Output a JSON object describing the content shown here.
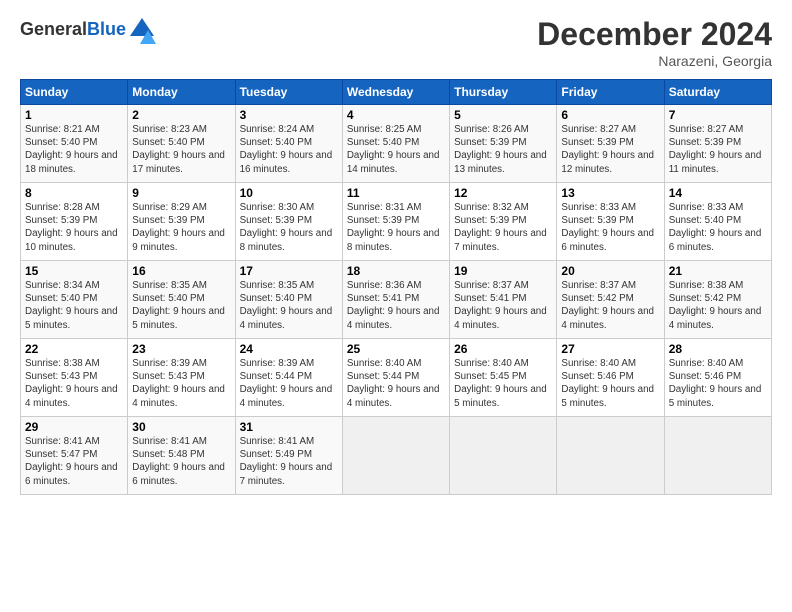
{
  "header": {
    "logo_line1": "General",
    "logo_line2": "Blue",
    "month": "December 2024",
    "location": "Narazeni, Georgia"
  },
  "weekdays": [
    "Sunday",
    "Monday",
    "Tuesday",
    "Wednesday",
    "Thursday",
    "Friday",
    "Saturday"
  ],
  "weeks": [
    [
      {
        "day": "1",
        "info": "Sunrise: 8:21 AM\nSunset: 5:40 PM\nDaylight: 9 hours and 18 minutes."
      },
      {
        "day": "2",
        "info": "Sunrise: 8:23 AM\nSunset: 5:40 PM\nDaylight: 9 hours and 17 minutes."
      },
      {
        "day": "3",
        "info": "Sunrise: 8:24 AM\nSunset: 5:40 PM\nDaylight: 9 hours and 16 minutes."
      },
      {
        "day": "4",
        "info": "Sunrise: 8:25 AM\nSunset: 5:40 PM\nDaylight: 9 hours and 14 minutes."
      },
      {
        "day": "5",
        "info": "Sunrise: 8:26 AM\nSunset: 5:39 PM\nDaylight: 9 hours and 13 minutes."
      },
      {
        "day": "6",
        "info": "Sunrise: 8:27 AM\nSunset: 5:39 PM\nDaylight: 9 hours and 12 minutes."
      },
      {
        "day": "7",
        "info": "Sunrise: 8:27 AM\nSunset: 5:39 PM\nDaylight: 9 hours and 11 minutes."
      }
    ],
    [
      {
        "day": "8",
        "info": "Sunrise: 8:28 AM\nSunset: 5:39 PM\nDaylight: 9 hours and 10 minutes."
      },
      {
        "day": "9",
        "info": "Sunrise: 8:29 AM\nSunset: 5:39 PM\nDaylight: 9 hours and 9 minutes."
      },
      {
        "day": "10",
        "info": "Sunrise: 8:30 AM\nSunset: 5:39 PM\nDaylight: 9 hours and 8 minutes."
      },
      {
        "day": "11",
        "info": "Sunrise: 8:31 AM\nSunset: 5:39 PM\nDaylight: 9 hours and 8 minutes."
      },
      {
        "day": "12",
        "info": "Sunrise: 8:32 AM\nSunset: 5:39 PM\nDaylight: 9 hours and 7 minutes."
      },
      {
        "day": "13",
        "info": "Sunrise: 8:33 AM\nSunset: 5:39 PM\nDaylight: 9 hours and 6 minutes."
      },
      {
        "day": "14",
        "info": "Sunrise: 8:33 AM\nSunset: 5:40 PM\nDaylight: 9 hours and 6 minutes."
      }
    ],
    [
      {
        "day": "15",
        "info": "Sunrise: 8:34 AM\nSunset: 5:40 PM\nDaylight: 9 hours and 5 minutes."
      },
      {
        "day": "16",
        "info": "Sunrise: 8:35 AM\nSunset: 5:40 PM\nDaylight: 9 hours and 5 minutes."
      },
      {
        "day": "17",
        "info": "Sunrise: 8:35 AM\nSunset: 5:40 PM\nDaylight: 9 hours and 4 minutes."
      },
      {
        "day": "18",
        "info": "Sunrise: 8:36 AM\nSunset: 5:41 PM\nDaylight: 9 hours and 4 minutes."
      },
      {
        "day": "19",
        "info": "Sunrise: 8:37 AM\nSunset: 5:41 PM\nDaylight: 9 hours and 4 minutes."
      },
      {
        "day": "20",
        "info": "Sunrise: 8:37 AM\nSunset: 5:42 PM\nDaylight: 9 hours and 4 minutes."
      },
      {
        "day": "21",
        "info": "Sunrise: 8:38 AM\nSunset: 5:42 PM\nDaylight: 9 hours and 4 minutes."
      }
    ],
    [
      {
        "day": "22",
        "info": "Sunrise: 8:38 AM\nSunset: 5:43 PM\nDaylight: 9 hours and 4 minutes."
      },
      {
        "day": "23",
        "info": "Sunrise: 8:39 AM\nSunset: 5:43 PM\nDaylight: 9 hours and 4 minutes."
      },
      {
        "day": "24",
        "info": "Sunrise: 8:39 AM\nSunset: 5:44 PM\nDaylight: 9 hours and 4 minutes."
      },
      {
        "day": "25",
        "info": "Sunrise: 8:40 AM\nSunset: 5:44 PM\nDaylight: 9 hours and 4 minutes."
      },
      {
        "day": "26",
        "info": "Sunrise: 8:40 AM\nSunset: 5:45 PM\nDaylight: 9 hours and 5 minutes."
      },
      {
        "day": "27",
        "info": "Sunrise: 8:40 AM\nSunset: 5:46 PM\nDaylight: 9 hours and 5 minutes."
      },
      {
        "day": "28",
        "info": "Sunrise: 8:40 AM\nSunset: 5:46 PM\nDaylight: 9 hours and 5 minutes."
      }
    ],
    [
      {
        "day": "29",
        "info": "Sunrise: 8:41 AM\nSunset: 5:47 PM\nDaylight: 9 hours and 6 minutes."
      },
      {
        "day": "30",
        "info": "Sunrise: 8:41 AM\nSunset: 5:48 PM\nDaylight: 9 hours and 6 minutes."
      },
      {
        "day": "31",
        "info": "Sunrise: 8:41 AM\nSunset: 5:49 PM\nDaylight: 9 hours and 7 minutes."
      },
      {
        "day": "",
        "info": ""
      },
      {
        "day": "",
        "info": ""
      },
      {
        "day": "",
        "info": ""
      },
      {
        "day": "",
        "info": ""
      }
    ]
  ]
}
